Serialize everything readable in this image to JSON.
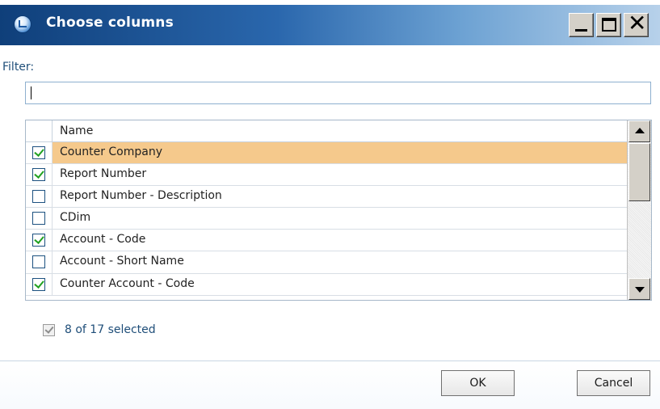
{
  "window": {
    "title": "Choose columns",
    "icon": "app-icon"
  },
  "filter": {
    "label": "Filter:",
    "value": "",
    "placeholder": ""
  },
  "grid": {
    "column_header": "Name",
    "rows": [
      {
        "label": "Counter Company",
        "checked": true,
        "selected": true
      },
      {
        "label": "Report Number",
        "checked": true,
        "selected": false
      },
      {
        "label": "Report Number - Description",
        "checked": false,
        "selected": false
      },
      {
        "label": "CDim",
        "checked": false,
        "selected": false
      },
      {
        "label": "Account - Code",
        "checked": true,
        "selected": false
      },
      {
        "label": "Account - Short Name",
        "checked": false,
        "selected": false
      },
      {
        "label": "Counter Account - Code",
        "checked": true,
        "selected": false
      }
    ]
  },
  "selection": {
    "summary": "8 of 17 selected"
  },
  "buttons": {
    "ok": "OK",
    "cancel": "Cancel"
  },
  "colors": {
    "selected_row": "#f5c98c",
    "checkmark": "#21a121",
    "link_text": "#1f4e79"
  }
}
